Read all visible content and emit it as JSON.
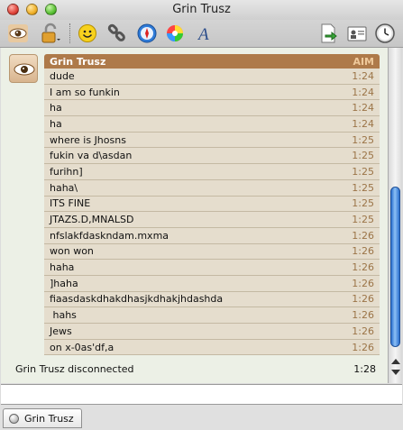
{
  "window": {
    "title": "Grin Trusz"
  },
  "message": {
    "sender": "Grin Trusz",
    "service": "AIM",
    "lines": [
      {
        "text": "dude",
        "time": "1:24"
      },
      {
        "text": "I am so funkin",
        "time": "1:24"
      },
      {
        "text": "ha",
        "time": "1:24"
      },
      {
        "text": "ha",
        "time": "1:24"
      },
      {
        "text": "where is Jhosns",
        "time": "1:25"
      },
      {
        "text": "fukin va d\\asdan",
        "time": "1:25"
      },
      {
        "text": "furihn]",
        "time": "1:25"
      },
      {
        "text": "haha\\",
        "time": "1:25"
      },
      {
        "text": "ITS FINE",
        "time": "1:25"
      },
      {
        "text": "JTAZS.D,MNALSD",
        "time": "1:25"
      },
      {
        "text": "nfslakfdaskndam.mxma",
        "time": "1:26"
      },
      {
        "text": "won won",
        "time": "1:26"
      },
      {
        "text": "haha",
        "time": "1:26"
      },
      {
        "text": "]haha",
        "time": "1:26"
      },
      {
        "text": "fiaasdaskdhakdhasjkdhakjhdashda",
        "time": "1:26"
      },
      {
        "text": " hahs",
        "time": "1:26"
      },
      {
        "text": "Jews",
        "time": "1:26"
      },
      {
        "text": "on x-0as'df,a",
        "time": "1:26"
      }
    ]
  },
  "status": {
    "text": "Grin Trusz disconnected",
    "time": "1:28"
  },
  "tabs": [
    {
      "label": "Grin Trusz"
    }
  ],
  "icons": [
    "eye-icon",
    "lock-icon",
    "smiley-icon",
    "link-icon",
    "compass-icon",
    "color-wheel-icon",
    "font-icon",
    "send-file-icon",
    "contact-info-icon",
    "clock-icon"
  ]
}
